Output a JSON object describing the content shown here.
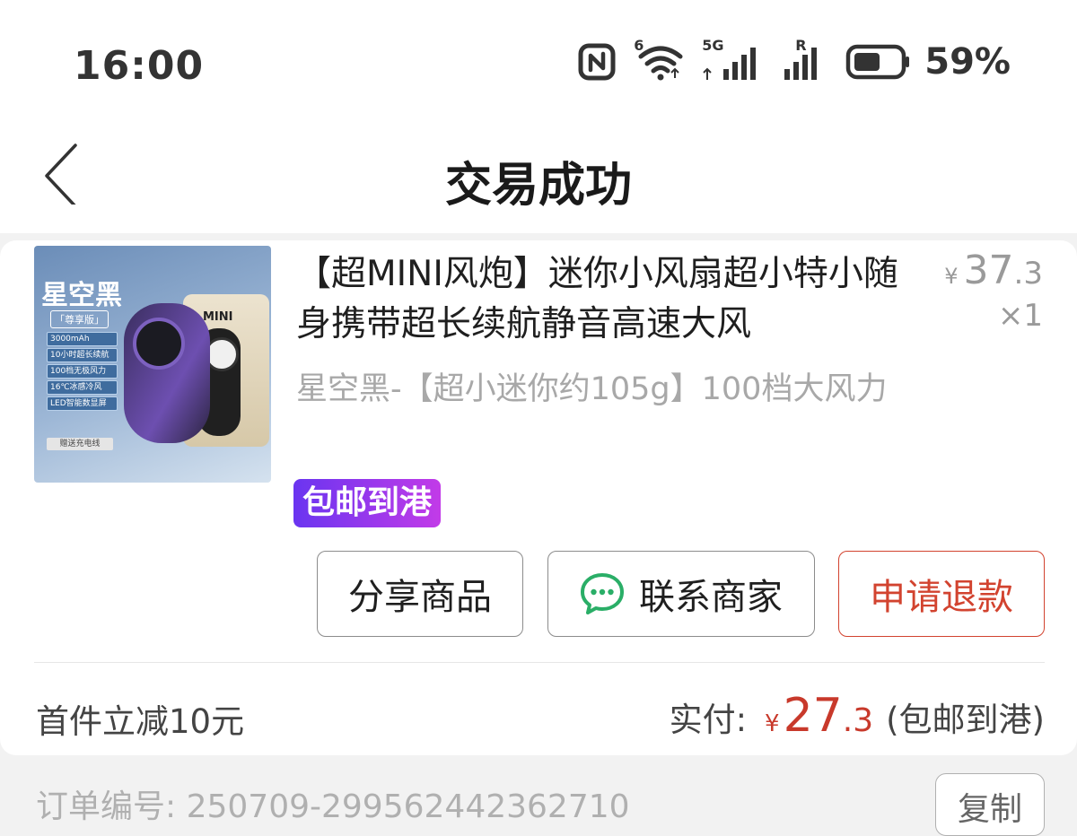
{
  "status_bar": {
    "time": "16:00",
    "wifi_label": "6",
    "cell1_label": "5G",
    "cell2_label": "R",
    "battery_percent": "59%",
    "battery_level": 0.59
  },
  "header": {
    "title": "交易成功",
    "back_icon": "chevron-left-icon"
  },
  "product": {
    "image_text": {
      "brand": "星空黑",
      "edition": "「尊享版」",
      "features": [
        "3000mAh",
        "10小时超长续航",
        "100档无极风力",
        "16℃冰感冷风",
        "LED智能数显屏"
      ],
      "cable": "赠送充电线",
      "box_label": "MINI"
    },
    "title": "【超MINI风炮】迷你小风扇超小特小随身携带超长续航静音高速大风",
    "spec": "星空黑-【超小迷你约105g】100档大风力",
    "price_currency": "¥",
    "price_int": "37",
    "price_dec": ".3",
    "quantity": "×1",
    "badge": "包邮到港"
  },
  "actions": {
    "share": "分享商品",
    "contact": "联系商家",
    "refund": "申请退款"
  },
  "summary": {
    "discount": "首件立减10元",
    "paid_label": "实付:",
    "paid_currency": "¥",
    "paid_int": "27",
    "paid_dec": ".3",
    "paid_note": "(包邮到港)"
  },
  "order": {
    "label": "订单编号: 250709-299562442362710",
    "copy": "复制"
  },
  "colors": {
    "accent_red": "#d2432f",
    "price_red": "#c8392b",
    "badge_gradient": [
      "#6a35f0",
      "#c23be8"
    ],
    "wechat_green": "#2aae67"
  }
}
